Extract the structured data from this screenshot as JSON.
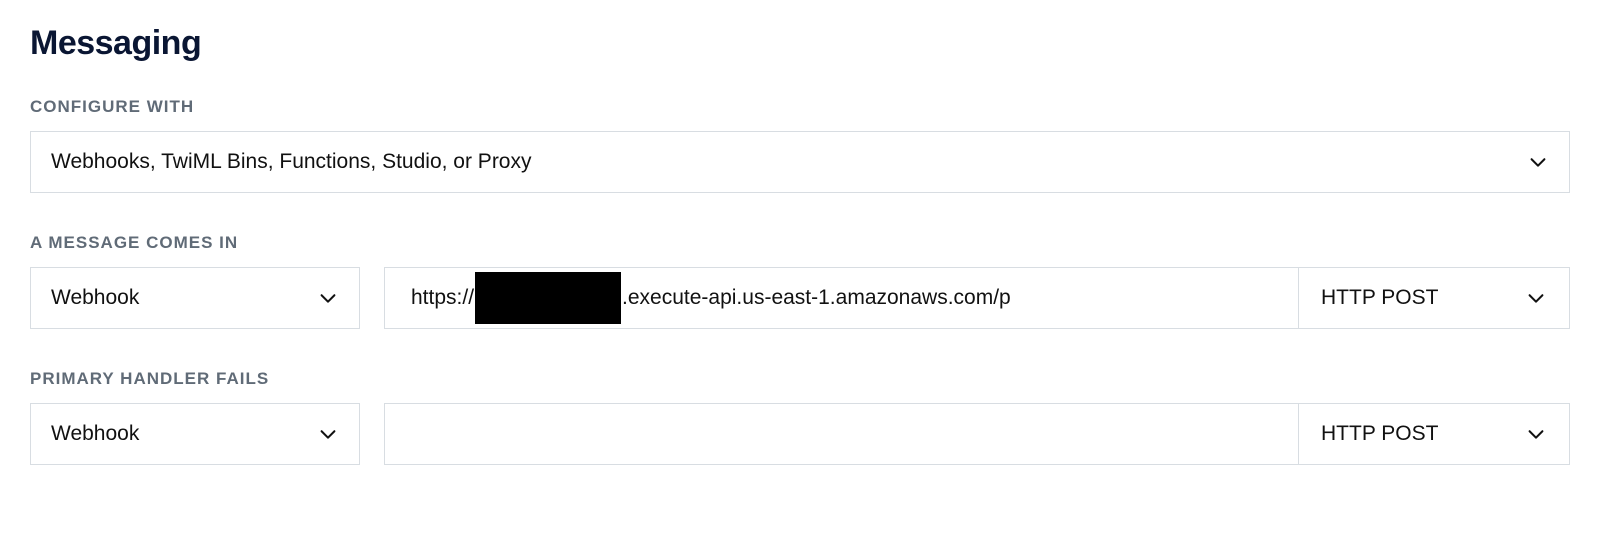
{
  "section": {
    "title": "Messaging"
  },
  "configure_with": {
    "label": "CONFIGURE WITH",
    "value": "Webhooks, TwiML Bins, Functions, Studio, or Proxy"
  },
  "message_comes_in": {
    "label": "A MESSAGE COMES IN",
    "handler_value": "Webhook",
    "url_prefix": "https://",
    "url_suffix": ".execute-api.us-east-1.amazonaws.com/p",
    "method_value": "HTTP POST"
  },
  "primary_handler_fails": {
    "label": "PRIMARY HANDLER FAILS",
    "handler_value": "Webhook",
    "url_value": "",
    "method_value": "HTTP POST"
  }
}
